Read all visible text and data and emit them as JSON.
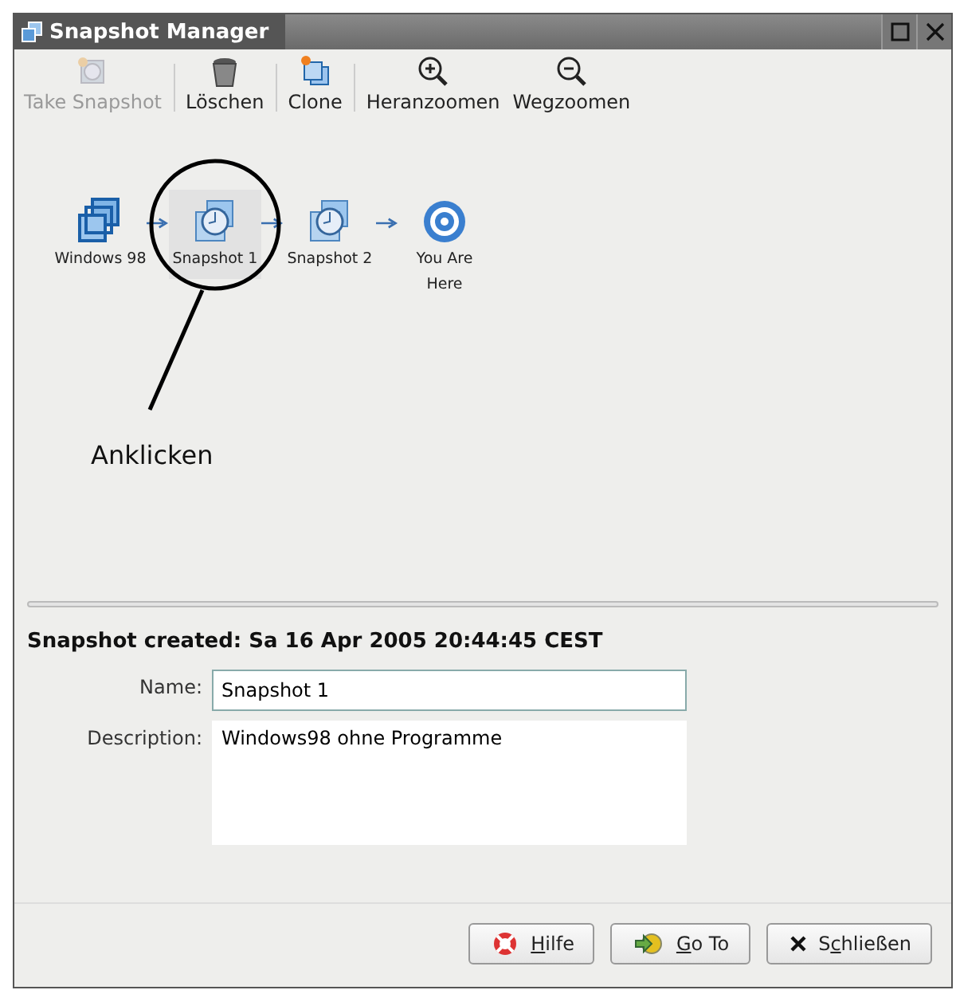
{
  "window": {
    "title": "Snapshot Manager"
  },
  "toolbar": [
    {
      "kind": "camera",
      "label": "Take Snapshot",
      "disabled": true,
      "separator_after": true
    },
    {
      "kind": "trash",
      "label": "Löschen",
      "disabled": false,
      "separator_after": true
    },
    {
      "kind": "clone",
      "label": "Clone",
      "disabled": false,
      "separator_after": true
    },
    {
      "kind": "zoom-in",
      "label": "Heranzoomen",
      "disabled": false,
      "separator_after": false
    },
    {
      "kind": "zoom-out",
      "label": "Wegzoomen",
      "disabled": false,
      "separator_after": false
    }
  ],
  "snapshot_tree": [
    {
      "kind": "vm",
      "label": "Windows 98",
      "selected": false
    },
    {
      "kind": "snapshot",
      "label": "Snapshot 1",
      "selected": true
    },
    {
      "kind": "snapshot",
      "label": "Snapshot 2",
      "selected": false
    },
    {
      "kind": "here",
      "label": "You Are Here",
      "selected": false
    }
  ],
  "annotation": {
    "text": "Anklicken"
  },
  "details": {
    "created": "Snapshot created: Sa 16 Apr 2005 20:44:45 CEST",
    "name_label": "Name:",
    "name_value": "Snapshot 1",
    "description_label": "Description:",
    "description_value": "Windows98 ohne Programme"
  },
  "buttons": [
    {
      "kind": "help",
      "key": "H",
      "post": "ilfe"
    },
    {
      "kind": "goto",
      "key": "G",
      "post": "o To"
    },
    {
      "kind": "close",
      "pre": "S",
      "key": "c",
      "post": "hließen"
    }
  ]
}
